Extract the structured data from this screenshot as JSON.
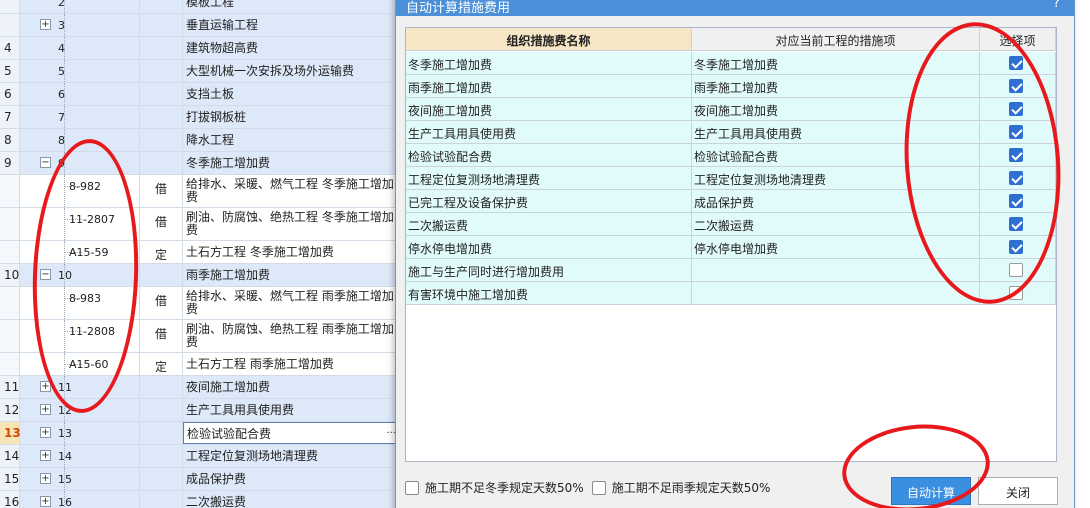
{
  "grid": {
    "rows": [
      {
        "num": "",
        "code": "2",
        "type": "",
        "name": "模板工程",
        "style": "blue",
        "expander": "",
        "level": 0,
        "partial": true
      },
      {
        "num": "",
        "code": "3",
        "type": "",
        "name": "垂直运输工程",
        "style": "blue",
        "expander": "+",
        "level": 0
      },
      {
        "num": "4",
        "code": "4",
        "type": "",
        "name": "建筑物超高费",
        "style": "blue",
        "expander": "",
        "level": 0
      },
      {
        "num": "5",
        "code": "5",
        "type": "",
        "name": "大型机械一次安拆及场外运输费",
        "style": "blue",
        "expander": "",
        "level": 0
      },
      {
        "num": "6",
        "code": "6",
        "type": "",
        "name": "支挡土板",
        "style": "blue",
        "expander": "",
        "level": 0
      },
      {
        "num": "7",
        "code": "7",
        "type": "",
        "name": "打拔钢板桩",
        "style": "blue",
        "expander": "",
        "level": 0
      },
      {
        "num": "8",
        "code": "8",
        "type": "",
        "name": "降水工程",
        "style": "blue",
        "expander": "",
        "level": 0
      },
      {
        "num": "9",
        "code": "9",
        "type": "",
        "name": "冬季施工增加费",
        "style": "blue",
        "expander": "−",
        "level": 0
      },
      {
        "num": "",
        "code": "8-982",
        "type": "借",
        "name": "给排水、采暖、燃气工程 冬季施工增加费",
        "style": "white",
        "expander": "",
        "level": 1,
        "tall": true
      },
      {
        "num": "",
        "code": "11-2807",
        "type": "借",
        "name": "刷油、防腐蚀、绝热工程 冬季施工增加费",
        "style": "white",
        "expander": "",
        "level": 1,
        "tall": true
      },
      {
        "num": "",
        "code": "A15-59",
        "type": "定",
        "name": "土石方工程 冬季施工增加费",
        "style": "white",
        "expander": "",
        "level": 1
      },
      {
        "num": "10",
        "code": "10",
        "type": "",
        "name": "雨季施工增加费",
        "style": "blue",
        "expander": "−",
        "level": 0
      },
      {
        "num": "",
        "code": "8-983",
        "type": "借",
        "name": "给排水、采暖、燃气工程 雨季施工增加费",
        "style": "white",
        "expander": "",
        "level": 1,
        "tall": true
      },
      {
        "num": "",
        "code": "11-2808",
        "type": "借",
        "name": "刷油、防腐蚀、绝热工程 雨季施工增加费",
        "style": "white",
        "expander": "",
        "level": 1,
        "tall": true
      },
      {
        "num": "",
        "code": "A15-60",
        "type": "定",
        "name": "土石方工程 雨季施工增加费",
        "style": "white",
        "expander": "",
        "level": 1
      },
      {
        "num": "11",
        "code": "11",
        "type": "",
        "name": "夜间施工增加费",
        "style": "blue",
        "expander": "+",
        "level": 0
      },
      {
        "num": "12",
        "code": "12",
        "type": "",
        "name": "生产工具用具使用费",
        "style": "blue",
        "expander": "+",
        "level": 0
      },
      {
        "num": "13",
        "code": "13",
        "type": "",
        "name": "检验试验配合费",
        "style": "blue",
        "expander": "+",
        "level": 0,
        "selected": true
      },
      {
        "num": "14",
        "code": "14",
        "type": "",
        "name": "工程定位复测场地清理费",
        "style": "blue",
        "expander": "+",
        "level": 0
      },
      {
        "num": "15",
        "code": "15",
        "type": "",
        "name": "成品保护费",
        "style": "blue",
        "expander": "+",
        "level": 0
      },
      {
        "num": "16",
        "code": "16",
        "type": "",
        "name": "二次搬运费",
        "style": "blue",
        "expander": "+",
        "level": 0
      }
    ],
    "selected_cell_ellipsis": "···"
  },
  "dialog": {
    "title": "自动计算措施费用",
    "help_label": "?",
    "columns": [
      "组织措施费名称",
      "对应当前工程的措施项",
      "选择项"
    ],
    "rows": [
      {
        "name": "冬季施工增加费",
        "item": "冬季施工增加费",
        "checked": true
      },
      {
        "name": "雨季施工增加费",
        "item": "雨季施工增加费",
        "checked": true
      },
      {
        "name": "夜间施工增加费",
        "item": "夜间施工增加费",
        "checked": true
      },
      {
        "name": "生产工具用具使用费",
        "item": "生产工具用具使用费",
        "checked": true
      },
      {
        "name": "检验试验配合费",
        "item": "检验试验配合费",
        "checked": true
      },
      {
        "name": "工程定位复测场地清理费",
        "item": "工程定位复测场地清理费",
        "checked": true
      },
      {
        "name": "已完工程及设备保护费",
        "item": "成品保护费",
        "checked": true
      },
      {
        "name": "二次搬运费",
        "item": "二次搬运费",
        "checked": true
      },
      {
        "name": "停水停电增加费",
        "item": "停水停电增加费",
        "checked": true
      },
      {
        "name": "施工与生产同时进行增加费用",
        "item": "",
        "checked": false
      },
      {
        "name": "有害环境中施工增加费",
        "item": "",
        "checked": false
      }
    ],
    "footer": {
      "winter_option": "施工期不足冬季规定天数50%",
      "rain_option": "施工期不足雨季规定天数50%",
      "auto_button": "自动计算",
      "close_button": "关闭"
    }
  },
  "colors": {
    "accent": "#3b8fe0",
    "title_bar": "#4a8fd8",
    "annotation": "#e8191d",
    "row_blue": "#dde8f8",
    "cell_cyan": "#e1fbfb"
  }
}
